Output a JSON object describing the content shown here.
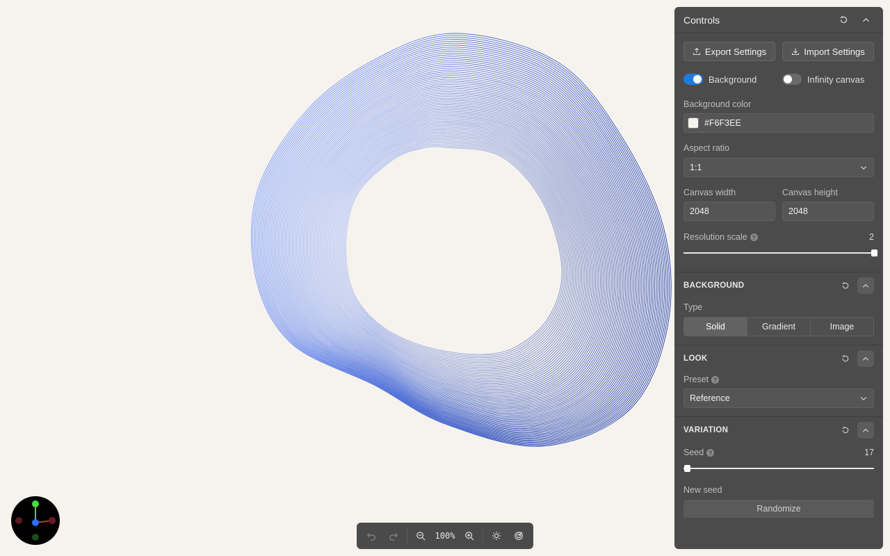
{
  "toolbar": {
    "zoom": "100%",
    "icons": [
      "undo-icon",
      "redo-icon",
      "zoom-out-icon",
      "zoom-in-icon",
      "sun-icon",
      "target-icon"
    ]
  },
  "gizmo": {
    "axis_colors": {
      "x": "#c0392b",
      "y": "#3fe03f",
      "z": "#2f6bff"
    }
  },
  "artwork": {
    "gradient_start": "#7b9dff",
    "gradient_end": "#1a3aa8"
  },
  "panel": {
    "title": "Controls",
    "export_label": "Export Settings",
    "import_label": "Import Settings",
    "toggles": {
      "background_label": "Background",
      "background_on": true,
      "infinity_label": "Infinity canvas",
      "infinity_on": false
    },
    "background_color": {
      "label": "Background color",
      "value": "#F6F3EE"
    },
    "aspect_ratio": {
      "label": "Aspect ratio",
      "value": "1:1"
    },
    "canvas_width": {
      "label": "Canvas width",
      "value": "2048"
    },
    "canvas_height": {
      "label": "Canvas height",
      "value": "2048"
    },
    "resolution_scale": {
      "label": "Resolution scale",
      "value": "2",
      "fraction": 1.0
    },
    "sections": {
      "background": {
        "title": "BACKGROUND",
        "type_label": "Type",
        "options": [
          "Solid",
          "Gradient",
          "Image"
        ],
        "selected": "Solid"
      },
      "look": {
        "title": "LOOK",
        "preset_label": "Preset",
        "preset_value": "Reference"
      },
      "variation": {
        "title": "VARIATION",
        "seed_label": "Seed",
        "seed_value": "17",
        "seed_fraction": 0.0,
        "new_seed_label": "New seed",
        "randomize_label": "Randomize"
      }
    }
  }
}
